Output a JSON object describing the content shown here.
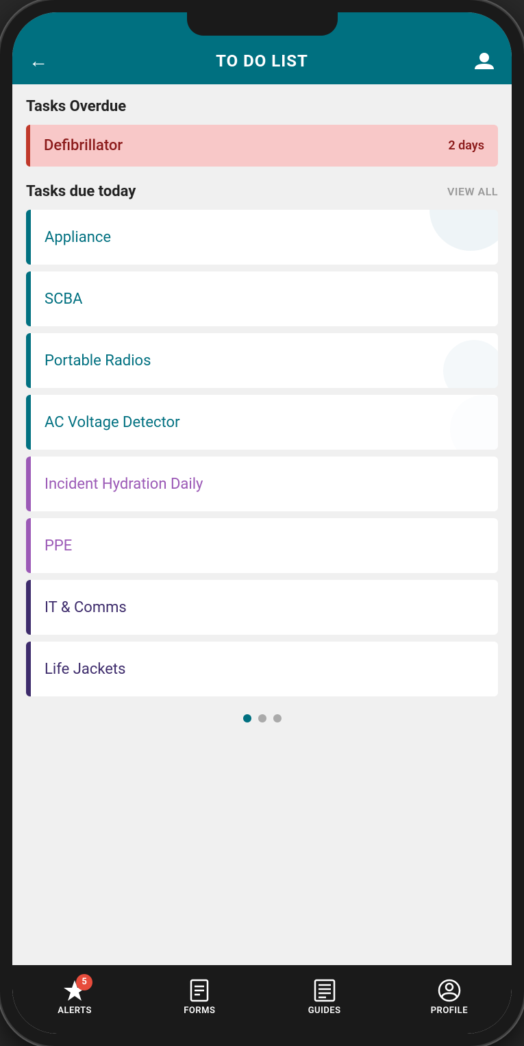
{
  "header": {
    "title": "TO DO LIST",
    "back_label": "←",
    "profile_label": "profile"
  },
  "overdue_section": {
    "title": "Tasks Overdue",
    "item": {
      "name": "Defibrillator",
      "days": "2 days"
    }
  },
  "today_section": {
    "title": "Tasks due today",
    "view_all_label": "VIEW ALL",
    "items": [
      {
        "name": "Appliance",
        "color": "teal"
      },
      {
        "name": "SCBA",
        "color": "teal"
      },
      {
        "name": "Portable Radios",
        "color": "teal"
      },
      {
        "name": "AC Voltage Detector",
        "color": "teal"
      },
      {
        "name": "Incident Hydration Daily",
        "color": "purple"
      },
      {
        "name": "PPE",
        "color": "purple"
      },
      {
        "name": "IT & Comms",
        "color": "dark-purple"
      },
      {
        "name": "Life Jackets",
        "color": "dark-purple"
      }
    ]
  },
  "pagination": {
    "dots": 3,
    "active": 1
  },
  "bottom_nav": {
    "items": [
      {
        "id": "alerts",
        "label": "ALERTS",
        "badge": "5"
      },
      {
        "id": "forms",
        "label": "FORMS",
        "badge": ""
      },
      {
        "id": "guides",
        "label": "GUIDES",
        "badge": ""
      },
      {
        "id": "profile",
        "label": "PROFILE",
        "badge": ""
      }
    ]
  }
}
